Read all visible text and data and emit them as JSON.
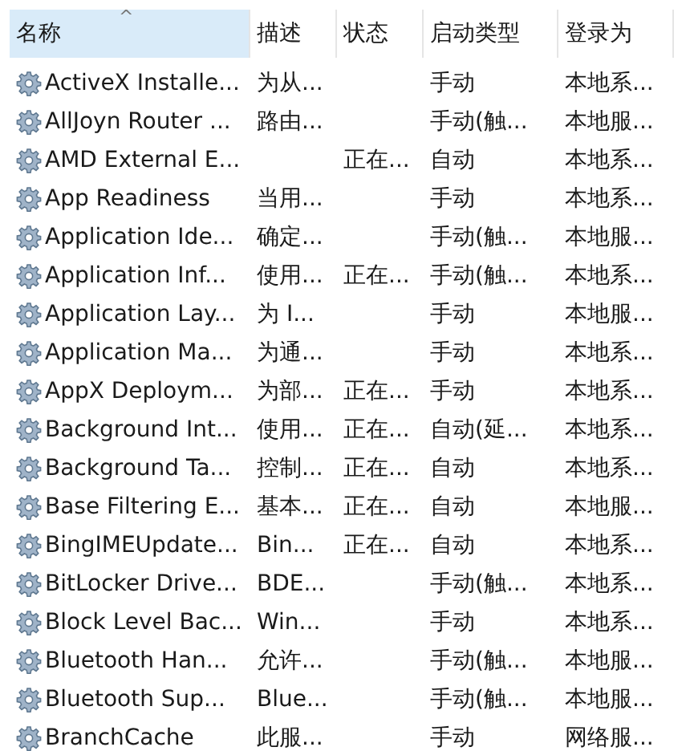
{
  "table": {
    "columns": [
      {
        "label": "名称",
        "sorted": true,
        "sort_indicator": "^"
      },
      {
        "label": "描述",
        "sorted": false
      },
      {
        "label": "状态",
        "sorted": false
      },
      {
        "label": "启动类型",
        "sorted": false
      },
      {
        "label": "登录为",
        "sorted": false
      }
    ],
    "rows": [
      {
        "cells": [
          "ActiveX Installe...",
          "为从...",
          "",
          "手动",
          "本地系..."
        ]
      },
      {
        "cells": [
          "AllJoyn Router ...",
          "路由...",
          "",
          "手动(触...",
          "本地服..."
        ]
      },
      {
        "cells": [
          "AMD External E...",
          "",
          "正在...",
          "自动",
          "本地系..."
        ]
      },
      {
        "cells": [
          "App Readiness",
          "当用...",
          "",
          "手动",
          "本地系..."
        ]
      },
      {
        "cells": [
          "Application Ide...",
          "确定...",
          "",
          "手动(触...",
          "本地服..."
        ]
      },
      {
        "cells": [
          "Application Inf...",
          "使用...",
          "正在...",
          "手动(触...",
          "本地系..."
        ]
      },
      {
        "cells": [
          "Application Lay...",
          "为 I...",
          "",
          "手动",
          "本地服..."
        ]
      },
      {
        "cells": [
          "Application Ma...",
          "为通...",
          "",
          "手动",
          "本地系..."
        ]
      },
      {
        "cells": [
          "AppX Deploym...",
          "为部...",
          "正在...",
          "手动",
          "本地系..."
        ]
      },
      {
        "cells": [
          "Background Int...",
          "使用...",
          "正在...",
          "自动(延...",
          "本地系..."
        ]
      },
      {
        "cells": [
          "Background Ta...",
          "控制...",
          "正在...",
          "自动",
          "本地系..."
        ]
      },
      {
        "cells": [
          "Base Filtering E...",
          "基本...",
          "正在...",
          "自动",
          "本地服..."
        ]
      },
      {
        "cells": [
          "BingIMEUpdate...",
          "Bin...",
          "正在...",
          "自动",
          "本地系..."
        ]
      },
      {
        "cells": [
          "BitLocker Drive...",
          "BDE...",
          "",
          "手动(触...",
          "本地系..."
        ]
      },
      {
        "cells": [
          "Block Level Bac...",
          "Win...",
          "",
          "手动",
          "本地系..."
        ]
      },
      {
        "cells": [
          "Bluetooth Han...",
          "允许...",
          "",
          "手动(触...",
          "本地服..."
        ]
      },
      {
        "cells": [
          "Bluetooth Sup...",
          "Blue...",
          "",
          "手动(触...",
          "本地服..."
        ]
      },
      {
        "cells": [
          "BranchCache",
          "此服...",
          "",
          "手动",
          "网络服..."
        ]
      }
    ]
  }
}
